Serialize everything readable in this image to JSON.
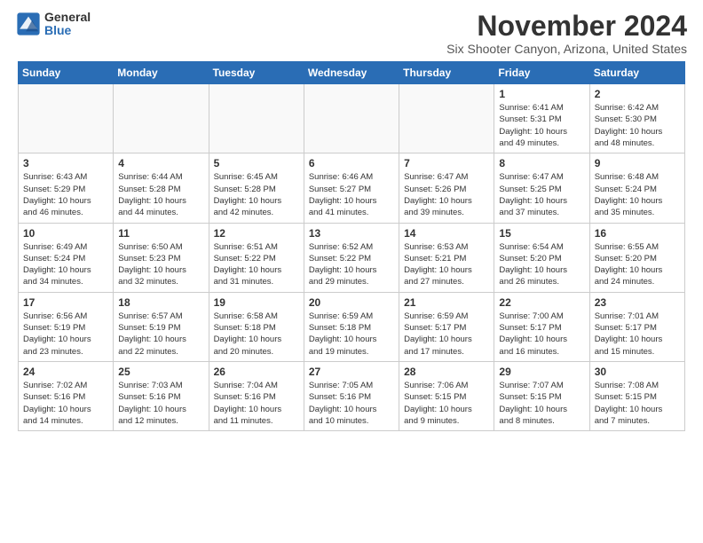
{
  "header": {
    "logo_general": "General",
    "logo_blue": "Blue",
    "month": "November 2024",
    "location": "Six Shooter Canyon, Arizona, United States"
  },
  "weekdays": [
    "Sunday",
    "Monday",
    "Tuesday",
    "Wednesday",
    "Thursday",
    "Friday",
    "Saturday"
  ],
  "weeks": [
    [
      {
        "day": "",
        "info": ""
      },
      {
        "day": "",
        "info": ""
      },
      {
        "day": "",
        "info": ""
      },
      {
        "day": "",
        "info": ""
      },
      {
        "day": "",
        "info": ""
      },
      {
        "day": "1",
        "info": "Sunrise: 6:41 AM\nSunset: 5:31 PM\nDaylight: 10 hours\nand 49 minutes."
      },
      {
        "day": "2",
        "info": "Sunrise: 6:42 AM\nSunset: 5:30 PM\nDaylight: 10 hours\nand 48 minutes."
      }
    ],
    [
      {
        "day": "3",
        "info": "Sunrise: 6:43 AM\nSunset: 5:29 PM\nDaylight: 10 hours\nand 46 minutes."
      },
      {
        "day": "4",
        "info": "Sunrise: 6:44 AM\nSunset: 5:28 PM\nDaylight: 10 hours\nand 44 minutes."
      },
      {
        "day": "5",
        "info": "Sunrise: 6:45 AM\nSunset: 5:28 PM\nDaylight: 10 hours\nand 42 minutes."
      },
      {
        "day": "6",
        "info": "Sunrise: 6:46 AM\nSunset: 5:27 PM\nDaylight: 10 hours\nand 41 minutes."
      },
      {
        "day": "7",
        "info": "Sunrise: 6:47 AM\nSunset: 5:26 PM\nDaylight: 10 hours\nand 39 minutes."
      },
      {
        "day": "8",
        "info": "Sunrise: 6:47 AM\nSunset: 5:25 PM\nDaylight: 10 hours\nand 37 minutes."
      },
      {
        "day": "9",
        "info": "Sunrise: 6:48 AM\nSunset: 5:24 PM\nDaylight: 10 hours\nand 35 minutes."
      }
    ],
    [
      {
        "day": "10",
        "info": "Sunrise: 6:49 AM\nSunset: 5:24 PM\nDaylight: 10 hours\nand 34 minutes."
      },
      {
        "day": "11",
        "info": "Sunrise: 6:50 AM\nSunset: 5:23 PM\nDaylight: 10 hours\nand 32 minutes."
      },
      {
        "day": "12",
        "info": "Sunrise: 6:51 AM\nSunset: 5:22 PM\nDaylight: 10 hours\nand 31 minutes."
      },
      {
        "day": "13",
        "info": "Sunrise: 6:52 AM\nSunset: 5:22 PM\nDaylight: 10 hours\nand 29 minutes."
      },
      {
        "day": "14",
        "info": "Sunrise: 6:53 AM\nSunset: 5:21 PM\nDaylight: 10 hours\nand 27 minutes."
      },
      {
        "day": "15",
        "info": "Sunrise: 6:54 AM\nSunset: 5:20 PM\nDaylight: 10 hours\nand 26 minutes."
      },
      {
        "day": "16",
        "info": "Sunrise: 6:55 AM\nSunset: 5:20 PM\nDaylight: 10 hours\nand 24 minutes."
      }
    ],
    [
      {
        "day": "17",
        "info": "Sunrise: 6:56 AM\nSunset: 5:19 PM\nDaylight: 10 hours\nand 23 minutes."
      },
      {
        "day": "18",
        "info": "Sunrise: 6:57 AM\nSunset: 5:19 PM\nDaylight: 10 hours\nand 22 minutes."
      },
      {
        "day": "19",
        "info": "Sunrise: 6:58 AM\nSunset: 5:18 PM\nDaylight: 10 hours\nand 20 minutes."
      },
      {
        "day": "20",
        "info": "Sunrise: 6:59 AM\nSunset: 5:18 PM\nDaylight: 10 hours\nand 19 minutes."
      },
      {
        "day": "21",
        "info": "Sunrise: 6:59 AM\nSunset: 5:17 PM\nDaylight: 10 hours\nand 17 minutes."
      },
      {
        "day": "22",
        "info": "Sunrise: 7:00 AM\nSunset: 5:17 PM\nDaylight: 10 hours\nand 16 minutes."
      },
      {
        "day": "23",
        "info": "Sunrise: 7:01 AM\nSunset: 5:17 PM\nDaylight: 10 hours\nand 15 minutes."
      }
    ],
    [
      {
        "day": "24",
        "info": "Sunrise: 7:02 AM\nSunset: 5:16 PM\nDaylight: 10 hours\nand 14 minutes."
      },
      {
        "day": "25",
        "info": "Sunrise: 7:03 AM\nSunset: 5:16 PM\nDaylight: 10 hours\nand 12 minutes."
      },
      {
        "day": "26",
        "info": "Sunrise: 7:04 AM\nSunset: 5:16 PM\nDaylight: 10 hours\nand 11 minutes."
      },
      {
        "day": "27",
        "info": "Sunrise: 7:05 AM\nSunset: 5:16 PM\nDaylight: 10 hours\nand 10 minutes."
      },
      {
        "day": "28",
        "info": "Sunrise: 7:06 AM\nSunset: 5:15 PM\nDaylight: 10 hours\nand 9 minutes."
      },
      {
        "day": "29",
        "info": "Sunrise: 7:07 AM\nSunset: 5:15 PM\nDaylight: 10 hours\nand 8 minutes."
      },
      {
        "day": "30",
        "info": "Sunrise: 7:08 AM\nSunset: 5:15 PM\nDaylight: 10 hours\nand 7 minutes."
      }
    ]
  ]
}
